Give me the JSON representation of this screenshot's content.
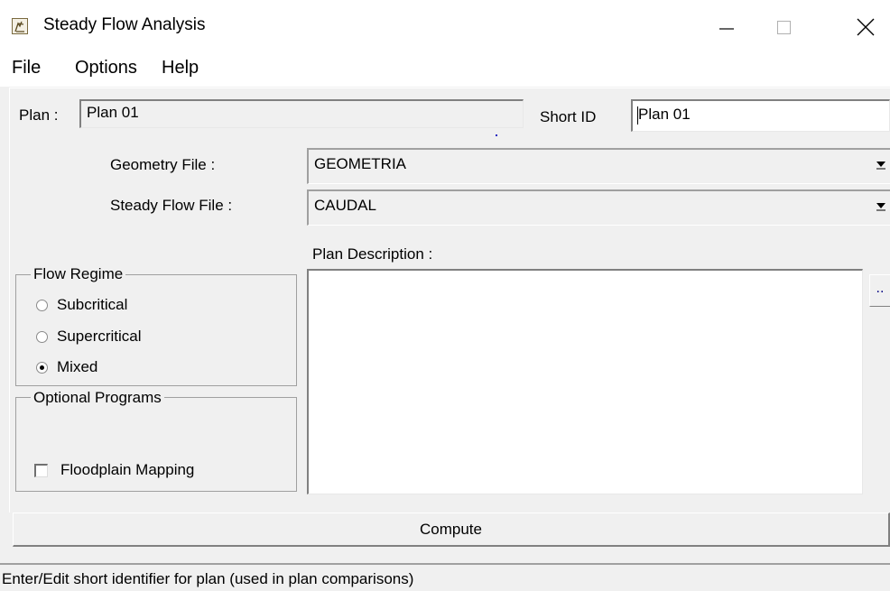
{
  "window": {
    "title": "Steady Flow Analysis",
    "app_icon": "hec-ras-app-icon",
    "controls": {
      "minimize": "—",
      "maximize": "☐",
      "close": "✕"
    }
  },
  "menu": [
    "File",
    "Options",
    "Help"
  ],
  "plan": {
    "label": "Plan :",
    "value": "Plan 01",
    "short_id_label": "Short ID",
    "short_id_value": "Plan 01"
  },
  "geometry": {
    "label": "Geometry File :",
    "selected": "GEOMETRIA"
  },
  "steady_flow": {
    "label": "Steady Flow File :",
    "selected": "CAUDAL"
  },
  "plan_description": {
    "label": "Plan Description :",
    "value": "",
    "ellipsis": ".."
  },
  "flow_regime": {
    "title": "Flow Regime",
    "options": [
      {
        "label": "Subcritical",
        "checked": false
      },
      {
        "label": "Supercritical",
        "checked": false
      },
      {
        "label": "Mixed",
        "checked": true
      }
    ]
  },
  "optional_programs": {
    "title": "Optional Programs",
    "floodplain_mapping": {
      "label": "Floodplain Mapping",
      "checked": false
    }
  },
  "compute_label": "Compute",
  "status": "Enter/Edit short identifier for plan (used in plan comparisons)"
}
